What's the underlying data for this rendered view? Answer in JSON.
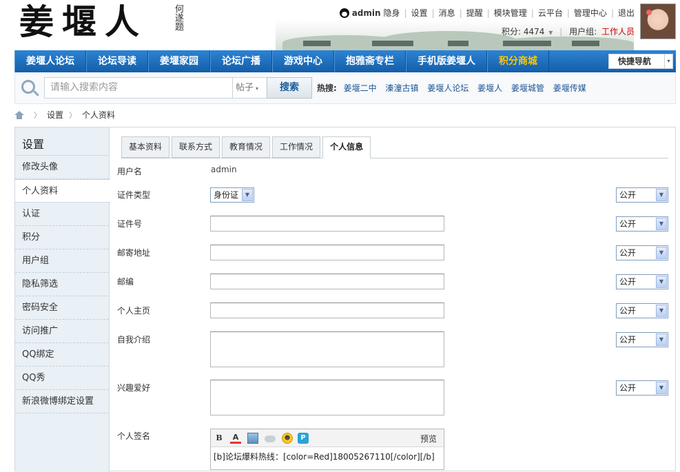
{
  "header": {
    "logo_text": "姜堰人",
    "logo_signature": "何遂题",
    "username": "admin",
    "top_links": [
      "隐身",
      "设置",
      "消息",
      "提醒",
      "模块管理",
      "云平台",
      "管理中心",
      "退出"
    ],
    "points_label": "积分: 4474",
    "points_arrow": "▼",
    "group_label": "用户组:",
    "group_value": "工作人员"
  },
  "nav": {
    "items": [
      "姜堰人论坛",
      "论坛导读",
      "姜堰家园",
      "论坛广播",
      "游戏中心",
      "抱雅斋专栏",
      "手机版姜堰人",
      "积分商城"
    ],
    "quick_nav": "快捷导航",
    "quick_arrow": "▾"
  },
  "search": {
    "placeholder": "请输入搜索内容",
    "type": "帖子",
    "type_arrow": "▾",
    "button": "搜索",
    "hot_label": "热搜:",
    "hot_links": [
      "姜堰二中",
      "溱潼古镇",
      "姜堰人论坛",
      "姜堰人",
      "姜堰城管",
      "姜堰传媒"
    ]
  },
  "breadcrumb": [
    "设置",
    "个人资料"
  ],
  "sidebar": {
    "title": "设置",
    "items": [
      "修改头像",
      "个人资料",
      "认证",
      "积分",
      "用户组",
      "隐私筛选",
      "密码安全",
      "访问推广",
      "QQ绑定",
      "QQ秀",
      "新浪微博绑定设置"
    ]
  },
  "tabs": [
    "基本资料",
    "联系方式",
    "教育情况",
    "工作情况",
    "个人信息"
  ],
  "form": {
    "username_label": "用户名",
    "username_value": "admin",
    "idtype_label": "证件类型",
    "idtype_value": "身份证",
    "idnum_label": "证件号",
    "address_label": "邮寄地址",
    "zipcode_label": "邮编",
    "homepage_label": "个人主页",
    "bio_label": "自我介绍",
    "interest_label": "兴趣爱好",
    "signature_label": "个人签名",
    "privacy_value": "公开",
    "dropdown_arrow": "▼",
    "editor_bold": "B",
    "editor_color": "A",
    "editor_p": "P",
    "editor_preview": "预览",
    "signature_content": "[b]论坛爆料热线：[color=Red]18005267110[/color][/b]"
  }
}
